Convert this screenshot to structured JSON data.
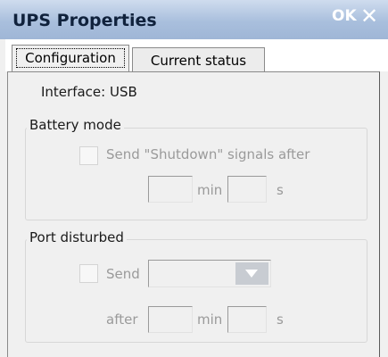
{
  "window": {
    "title": "UPS Properties",
    "ok_label": "OK",
    "close_icon": "close-icon"
  },
  "tabs": [
    {
      "label": "Configuration",
      "selected": true
    },
    {
      "label": "Current status",
      "selected": false
    }
  ],
  "interface": {
    "text": "Interface: USB"
  },
  "battery_mode": {
    "title": "Battery mode",
    "checkbox_label": "Send \"Shutdown\" signals after",
    "checked": false,
    "min_value": "",
    "min_unit": "min",
    "sec_value": "",
    "sec_unit": "s"
  },
  "port_disturbed": {
    "title": "Port disturbed",
    "checkbox_label": "Send",
    "checked": false,
    "select_value": "",
    "after_label": "after",
    "min_value": "",
    "min_unit": "min",
    "sec_value": "",
    "sec_unit": "s"
  }
}
